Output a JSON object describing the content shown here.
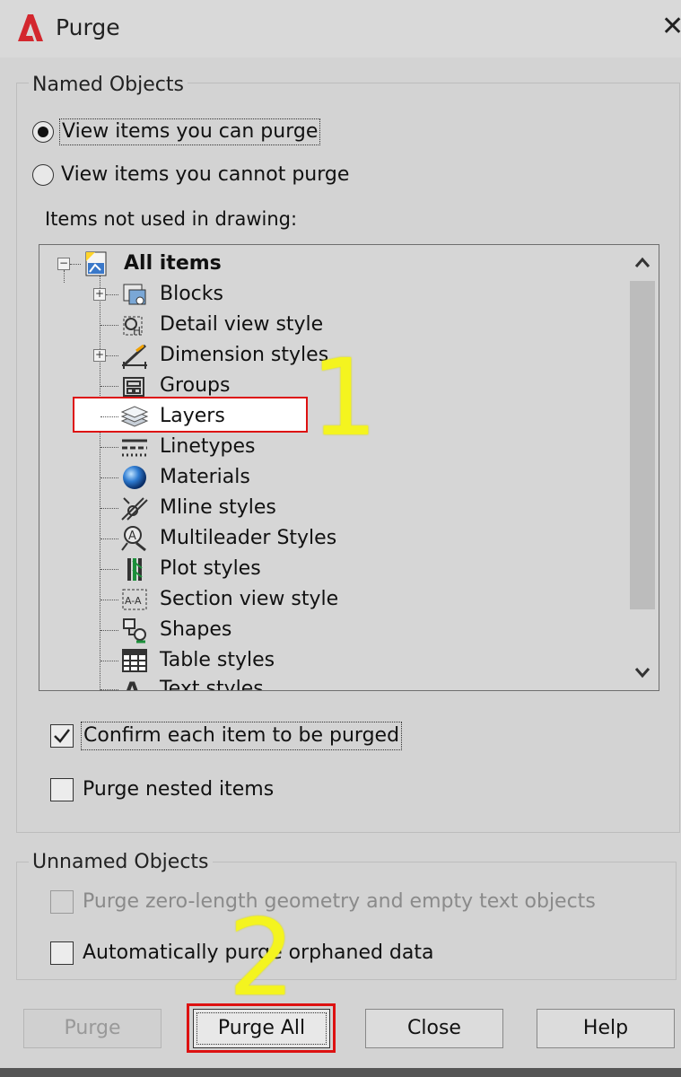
{
  "window": {
    "title": "Purge",
    "close_glyph": "✕"
  },
  "named_objects": {
    "title": "Named Objects",
    "radio_can": {
      "label": "View items you can purge",
      "selected": true
    },
    "radio_cannot": {
      "label": "View items you cannot purge",
      "selected": false
    },
    "items_caption": "Items not used in drawing:",
    "tree": {
      "root": {
        "label": "All items",
        "icon": "drawing-icon",
        "expanded": true
      },
      "items": [
        {
          "label": "Blocks",
          "icon": "blocks-icon",
          "has_children": true
        },
        {
          "label": "Detail view style",
          "icon": "detail-view-icon",
          "has_children": false
        },
        {
          "label": "Dimension styles",
          "icon": "dimension-icon",
          "has_children": true
        },
        {
          "label": "Groups",
          "icon": "groups-icon",
          "has_children": false
        },
        {
          "label": "Layers",
          "icon": "layers-icon",
          "has_children": false
        },
        {
          "label": "Linetypes",
          "icon": "linetypes-icon",
          "has_children": false
        },
        {
          "label": "Materials",
          "icon": "materials-icon",
          "has_children": false
        },
        {
          "label": "Mline styles",
          "icon": "mline-icon",
          "has_children": false
        },
        {
          "label": "Multileader Styles",
          "icon": "multileader-icon",
          "has_children": false
        },
        {
          "label": "Plot styles",
          "icon": "plot-styles-icon",
          "has_children": false
        },
        {
          "label": "Section view style",
          "icon": "section-view-icon",
          "has_children": false
        },
        {
          "label": "Shapes",
          "icon": "shapes-icon",
          "has_children": false
        },
        {
          "label": "Table styles",
          "icon": "table-icon",
          "has_children": false
        },
        {
          "label": "Text styles",
          "icon": "text-styles-icon",
          "has_children": false
        }
      ]
    },
    "confirm_check": {
      "label": "Confirm each item to be purged",
      "checked": true
    },
    "nested_check": {
      "label": "Purge nested items",
      "checked": false
    }
  },
  "unnamed_objects": {
    "title": "Unnamed Objects",
    "zero_length_check": {
      "label": "Purge zero-length geometry and empty text objects",
      "checked": false,
      "disabled": true
    },
    "orphan_check": {
      "label": "Automatically purge orphaned data",
      "checked": false
    }
  },
  "buttons": {
    "purge": {
      "label": "Purge",
      "disabled": true
    },
    "purge_all": {
      "label": "Purge All"
    },
    "close": {
      "label": "Close"
    },
    "help": {
      "label": "Help"
    }
  },
  "annotations": {
    "step1": "1",
    "step2": "2"
  },
  "colors": {
    "highlight_red": "#dd1111",
    "annotation_yellow": "#f4f41f",
    "dialog_bg": "#d3d3d3"
  }
}
